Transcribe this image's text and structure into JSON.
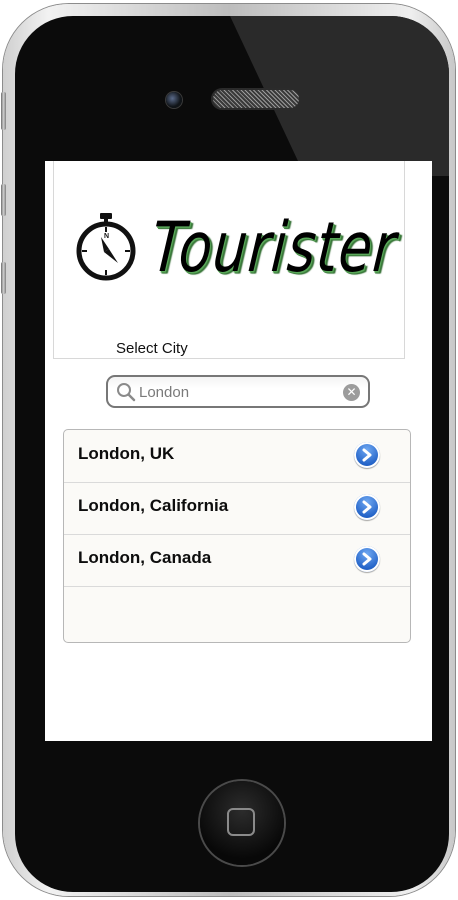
{
  "app": {
    "logo_text": "Tourister",
    "select_label": "Select City"
  },
  "search": {
    "value": "London",
    "placeholder": "London"
  },
  "results": [
    {
      "label": "London, UK"
    },
    {
      "label": "London, California"
    },
    {
      "label": "London, Canada"
    }
  ],
  "colors": {
    "accent_blue": "#1f5fc5",
    "logo_shadow_green": "#3c7c3c"
  },
  "icons": {
    "logo": "stopwatch-compass-icon",
    "search": "search-icon",
    "clear": "clear-icon",
    "disclosure": "chevron-right-circle-icon"
  }
}
